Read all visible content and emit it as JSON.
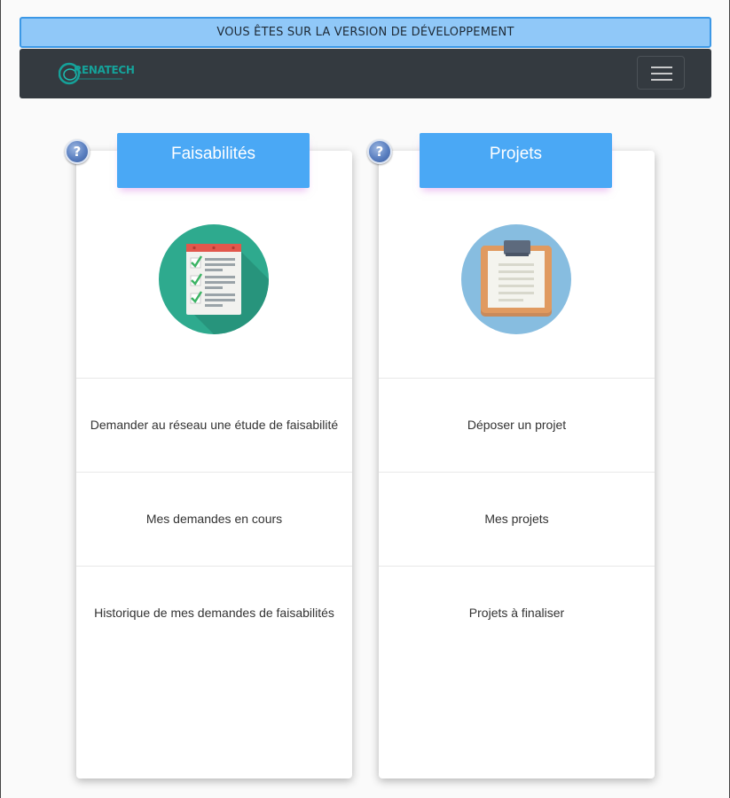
{
  "banner": {
    "text": "VOUS ÊTES SUR LA VERSION DE DÉVELOPPEMENT",
    "background": "#90c8f8",
    "border": "#3c98e6"
  },
  "navbar": {
    "brand": "RENATECH",
    "brand_color": "#15a29a",
    "background": "#343a40",
    "toggler_icon": "hamburger-menu-icon"
  },
  "cards": [
    {
      "title": "Faisabilités",
      "help_label": "?",
      "icon": "checklist-icon",
      "items": [
        "Demander au réseau une étude de faisabilité",
        "Mes demandes en cours",
        "Historique de mes demandes de faisabilités"
      ]
    },
    {
      "title": "Projets",
      "help_label": "?",
      "icon": "clipboard-icon",
      "items": [
        "Déposer un projet",
        "Mes projets",
        "Projets à finaliser"
      ]
    }
  ],
  "colors": {
    "card_header": "#4aa8f5",
    "checklist_circle": "#2eaa8e",
    "clipboard_circle": "#87bde0"
  }
}
